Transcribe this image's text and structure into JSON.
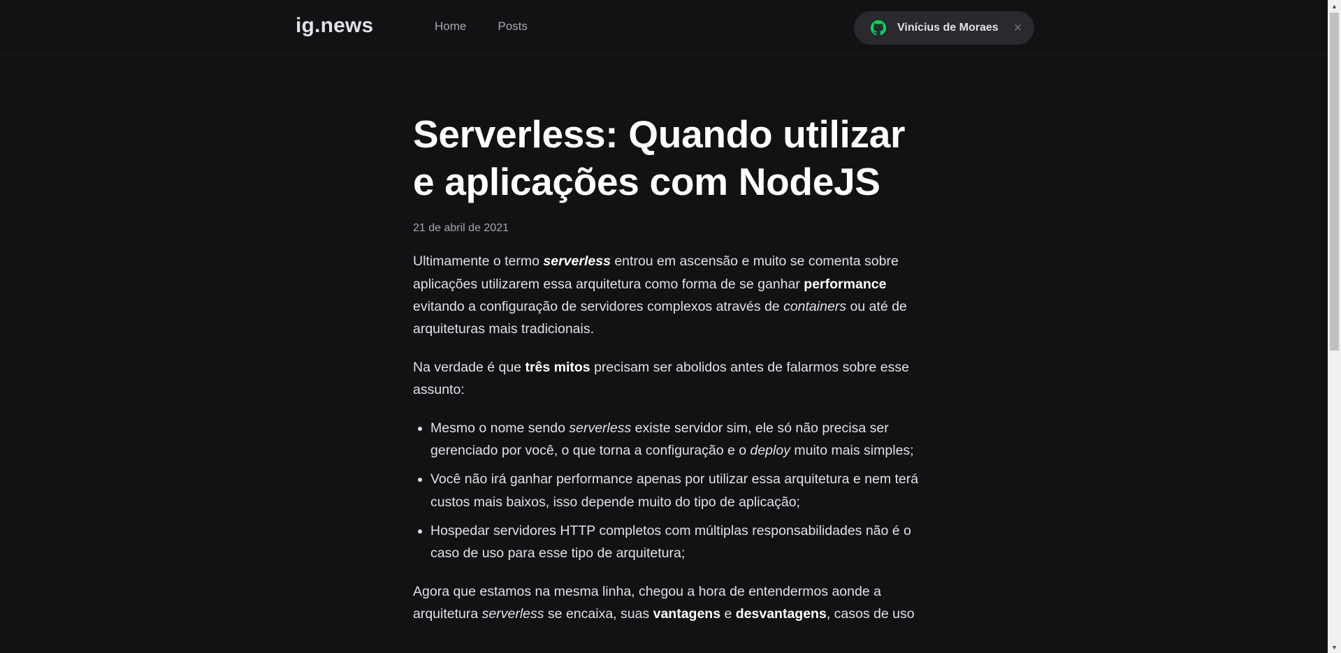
{
  "header": {
    "logo": "ig.news",
    "nav": [
      {
        "label": "Home"
      },
      {
        "label": "Posts"
      }
    ],
    "user": {
      "name": "Vinícius de Moraes",
      "icon": "github-icon",
      "close_icon": "×",
      "icon_color": "#04d361"
    }
  },
  "article": {
    "title": "Serverless: Quando utilizar e aplicações com NodeJS",
    "date": "21 de abril de 2021",
    "p1": {
      "a": "Ultimamente o termo ",
      "b": "serverless",
      "c": " entrou em ascensão e muito se comenta sobre aplicações utilizarem essa arquitetura como forma de se ganhar ",
      "d": "performance",
      "e": " evitando a configuração de servidores complexos através de ",
      "f": "containers",
      "g": " ou até de arquiteturas mais tradicionais."
    },
    "p2": {
      "a": "Na verdade é que ",
      "b": "três mitos",
      "c": " precisam ser abolidos antes de falarmos sobre esse assunto:"
    },
    "list": {
      "i1": {
        "a": "Mesmo o nome sendo ",
        "b": "serverless",
        "c": " existe servidor sim, ele só não precisa ser gerenciado por você, o que torna a configuração e o ",
        "d": "deploy",
        "e": " muito mais simples;"
      },
      "i2": "Você não irá ganhar performance apenas por utilizar essa arquitetura e nem terá custos mais baixos, isso depende muito do tipo de aplicação;",
      "i3": "Hospedar servidores HTTP completos com múltiplas responsabilidades não é o caso de uso para esse tipo de arquitetura;"
    },
    "p3": {
      "a": "Agora que estamos na mesma linha, chegou a hora de entendermos aonde a arquitetura ",
      "b": "serverless",
      "c": " se encaixa, suas ",
      "d": "vantagens",
      "e": " e ",
      "f": "desvantagens",
      "g": ", casos de uso"
    }
  },
  "colors": {
    "background": "#121214",
    "text": "#e1e1e6",
    "muted": "#a8a8b3",
    "accent": "#04d361"
  }
}
